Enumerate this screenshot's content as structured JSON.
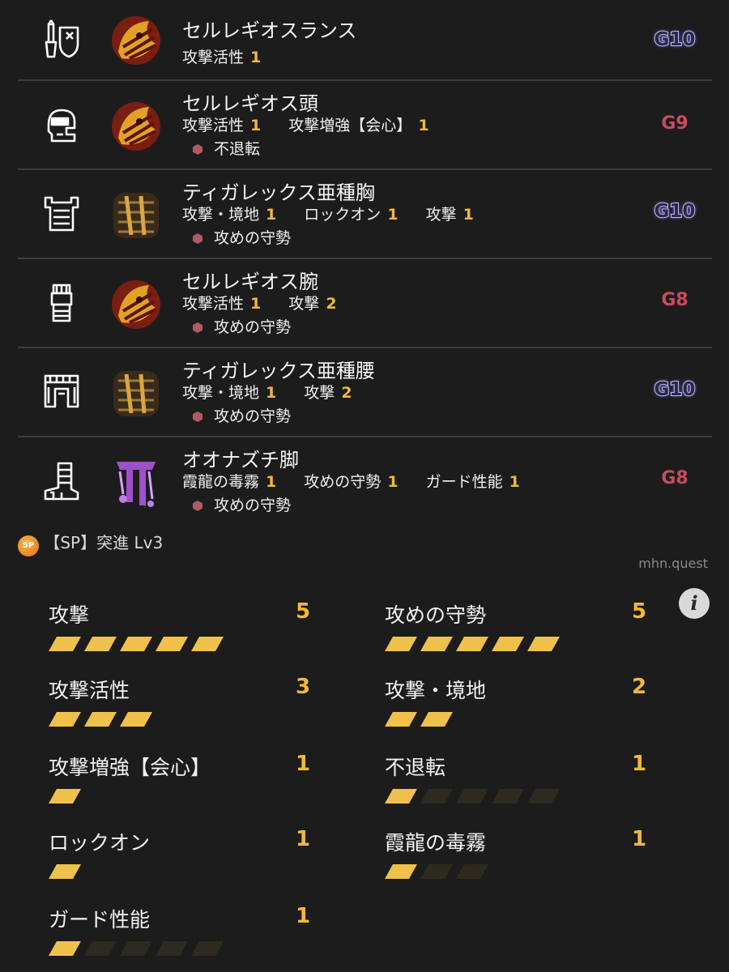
{
  "equipment": [
    {
      "slot": "weapon",
      "slot_icon": "lance-shield-icon",
      "monster_icon": "seregios-icon",
      "name": "セルレギオスランス",
      "skills": [
        {
          "name": "攻撃活性",
          "level": "1"
        }
      ],
      "deco": null,
      "grade": "G10"
    },
    {
      "slot": "head",
      "slot_icon": "helmet-icon",
      "monster_icon": "seregios-icon",
      "name": "セルレギオス頭",
      "skills": [
        {
          "name": "攻撃活性",
          "level": "1"
        },
        {
          "name": "攻撃増強【会心】",
          "level": "1"
        }
      ],
      "deco": "不退転",
      "grade": "G9"
    },
    {
      "slot": "chest",
      "slot_icon": "chest-armor-icon",
      "monster_icon": "tigrex-subspecies-icon",
      "name": "ティガレックス亜種胸",
      "skills": [
        {
          "name": "攻撃・境地",
          "level": "1"
        },
        {
          "name": "ロックオン",
          "level": "1"
        },
        {
          "name": "攻撃",
          "level": "1"
        }
      ],
      "deco": "攻めの守勢",
      "grade": "G10"
    },
    {
      "slot": "arms",
      "slot_icon": "gauntlet-icon",
      "monster_icon": "seregios-icon",
      "name": "セルレギオス腕",
      "skills": [
        {
          "name": "攻撃活性",
          "level": "1"
        },
        {
          "name": "攻撃",
          "level": "2"
        }
      ],
      "deco": "攻めの守勢",
      "grade": "G8"
    },
    {
      "slot": "waist",
      "slot_icon": "waist-armor-icon",
      "monster_icon": "tigrex-subspecies-icon",
      "name": "ティガレックス亜種腰",
      "skills": [
        {
          "name": "攻撃・境地",
          "level": "1"
        },
        {
          "name": "攻撃",
          "level": "2"
        }
      ],
      "deco": "攻めの守勢",
      "grade": "G10"
    },
    {
      "slot": "legs",
      "slot_icon": "greaves-icon",
      "monster_icon": "ohnazuchi-icon",
      "name": "オオナズチ脚",
      "skills": [
        {
          "name": "霞龍の毒霧",
          "level": "1"
        },
        {
          "name": "攻めの守勢",
          "level": "1"
        },
        {
          "name": "ガード性能",
          "level": "1"
        }
      ],
      "deco": "攻めの守勢",
      "grade": "G8"
    }
  ],
  "sp": {
    "badge": "SP",
    "label": "【SP】突進 Lv3"
  },
  "site": "mhn.quest",
  "info_icon": "info-icon",
  "skills_total": [
    {
      "name": "攻撃",
      "level": "5",
      "max": 5,
      "filled": 5
    },
    {
      "name": "攻めの守勢",
      "level": "5",
      "max": 5,
      "filled": 5
    },
    {
      "name": "攻撃活性",
      "level": "3",
      "max": 3,
      "filled": 3
    },
    {
      "name": "攻撃・境地",
      "level": "2",
      "max": 2,
      "filled": 2
    },
    {
      "name": "攻撃増強【会心】",
      "level": "1",
      "max": 1,
      "filled": 1
    },
    {
      "name": "不退転",
      "level": "1",
      "max": 5,
      "filled": 1
    },
    {
      "name": "ロックオン",
      "level": "1",
      "max": 1,
      "filled": 1
    },
    {
      "name": "霞龍の毒霧",
      "level": "1",
      "max": 3,
      "filled": 1
    },
    {
      "name": "ガード性能",
      "level": "1",
      "max": 5,
      "filled": 1
    }
  ],
  "colors": {
    "background": "#1c1c1c",
    "accent": "#f0b93c",
    "grade_red": "#c94a5f",
    "deco": "#b05a66"
  }
}
